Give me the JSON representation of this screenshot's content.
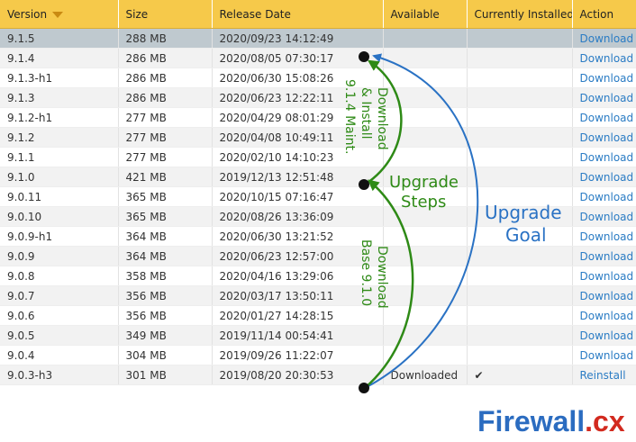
{
  "table": {
    "headers": {
      "version": "Version",
      "size": "Size",
      "release_date": "Release Date",
      "available": "Available",
      "installed": "Currently Installed",
      "action": "Action"
    },
    "rows": [
      {
        "version": "9.1.5",
        "size": "288 MB",
        "date": "2020/09/23 14:12:49",
        "available": "",
        "installed": "",
        "action": "Download"
      },
      {
        "version": "9.1.4",
        "size": "286 MB",
        "date": "2020/08/05 07:30:17",
        "available": "",
        "installed": "",
        "action": "Download"
      },
      {
        "version": "9.1.3-h1",
        "size": "286 MB",
        "date": "2020/06/30 15:08:26",
        "available": "",
        "installed": "",
        "action": "Download"
      },
      {
        "version": "9.1.3",
        "size": "286 MB",
        "date": "2020/06/23 12:22:11",
        "available": "",
        "installed": "",
        "action": "Download"
      },
      {
        "version": "9.1.2-h1",
        "size": "277 MB",
        "date": "2020/04/29 08:01:29",
        "available": "",
        "installed": "",
        "action": "Download"
      },
      {
        "version": "9.1.2",
        "size": "277 MB",
        "date": "2020/04/08 10:49:11",
        "available": "",
        "installed": "",
        "action": "Download"
      },
      {
        "version": "9.1.1",
        "size": "277 MB",
        "date": "2020/02/10 14:10:23",
        "available": "",
        "installed": "",
        "action": "Download"
      },
      {
        "version": "9.1.0",
        "size": "421 MB",
        "date": "2019/12/13 12:51:48",
        "available": "",
        "installed": "",
        "action": "Download"
      },
      {
        "version": "9.0.11",
        "size": "365 MB",
        "date": "2020/10/15 07:16:47",
        "available": "",
        "installed": "",
        "action": "Download"
      },
      {
        "version": "9.0.10",
        "size": "365 MB",
        "date": "2020/08/26 13:36:09",
        "available": "",
        "installed": "",
        "action": "Download"
      },
      {
        "version": "9.0.9-h1",
        "size": "364 MB",
        "date": "2020/06/30 13:21:52",
        "available": "",
        "installed": "",
        "action": "Download"
      },
      {
        "version": "9.0.9",
        "size": "364 MB",
        "date": "2020/06/23 12:57:00",
        "available": "",
        "installed": "",
        "action": "Download"
      },
      {
        "version": "9.0.8",
        "size": "358 MB",
        "date": "2020/04/16 13:29:06",
        "available": "",
        "installed": "",
        "action": "Download"
      },
      {
        "version": "9.0.7",
        "size": "356 MB",
        "date": "2020/03/17 13:50:11",
        "available": "",
        "installed": "",
        "action": "Download"
      },
      {
        "version": "9.0.6",
        "size": "356 MB",
        "date": "2020/01/27 14:28:15",
        "available": "",
        "installed": "",
        "action": "Download"
      },
      {
        "version": "9.0.5",
        "size": "349 MB",
        "date": "2019/11/14 00:54:41",
        "available": "",
        "installed": "",
        "action": "Download"
      },
      {
        "version": "9.0.4",
        "size": "304 MB",
        "date": "2019/09/26 11:22:07",
        "available": "",
        "installed": "",
        "action": "Download"
      },
      {
        "version": "9.0.3-h3",
        "size": "301 MB",
        "date": "2019/08/20 20:30:53",
        "available": "Downloaded",
        "installed": "✔",
        "action": "Reinstall"
      }
    ]
  },
  "annotations": {
    "upgrade_steps_line1": "Upgrade",
    "upgrade_steps_line2": "Steps",
    "upgrade_goal_line1": "Upgrade",
    "upgrade_goal_line2": "Goal",
    "download_install_line1": "Download",
    "download_install_line2": "& Install",
    "download_install_line3": "9.1.4 Maint.",
    "download_base_line1": "Download",
    "download_base_line2": "Base 9.1.0"
  },
  "logo": {
    "part1": "Firewall",
    "part2": ".cx"
  },
  "colors": {
    "header": "#f6c94a",
    "selected_row": "#bfc9cf",
    "link": "#2b7cc4",
    "annotation_green": "#2e8a16",
    "annotation_blue": "#2a72c4",
    "logo_blue": "#2b6cc0",
    "logo_red": "#d22a1f"
  }
}
